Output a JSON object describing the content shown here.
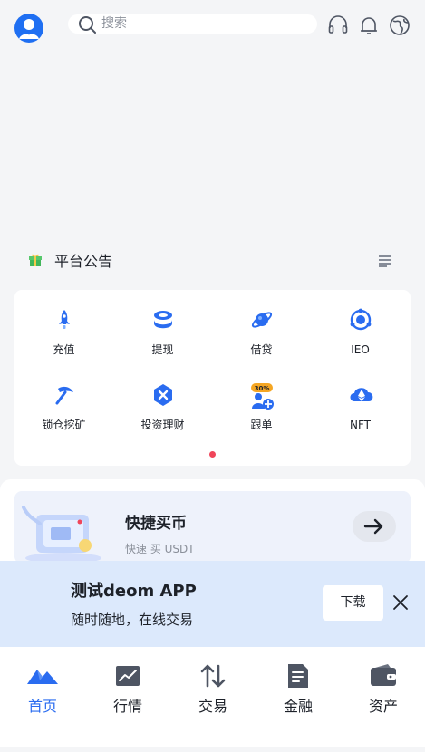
{
  "header": {
    "search_placeholder": "搜索",
    "icons": [
      "user-avatar-icon",
      "search-icon",
      "headset-icon",
      "bell-icon",
      "globe-icon"
    ]
  },
  "notice": {
    "title": "平台公告",
    "icons": [
      "gift-icon",
      "list-menu-icon"
    ]
  },
  "grid": {
    "items": [
      {
        "label": "充值",
        "icon": "rocket-icon"
      },
      {
        "label": "提现",
        "icon": "coin-stack-icon"
      },
      {
        "label": "借贷",
        "icon": "planet-icon"
      },
      {
        "label": "IEO",
        "icon": "target-icon"
      },
      {
        "label": "锁仓挖矿",
        "icon": "pickaxe-icon"
      },
      {
        "label": "投资理财",
        "icon": "hexagon-x-icon"
      },
      {
        "label": "跟单",
        "icon": "copy-trade-icon",
        "badge": "30%"
      },
      {
        "label": "NFT",
        "icon": "cloud-ethereum-icon"
      }
    ],
    "page_indicator_active": 1
  },
  "quick_buy": {
    "title": "快捷买币",
    "subtitle": "快速 买 USDT",
    "icon": "arrow-right-icon"
  },
  "download_banner": {
    "title": "测试deom APP",
    "subtitle": "随时随地，在线交易",
    "button": "下载",
    "close_icon": "close-icon"
  },
  "tabbar": {
    "active_index": 0,
    "tabs": [
      {
        "label": "首页",
        "icon": "home-mountain-icon"
      },
      {
        "label": "行情",
        "icon": "market-chart-icon"
      },
      {
        "label": "交易",
        "icon": "trade-arrows-icon"
      },
      {
        "label": "金融",
        "icon": "finance-doc-icon"
      },
      {
        "label": "资产",
        "icon": "wallet-icon"
      }
    ]
  },
  "colors": {
    "accent": "#2a6cf0",
    "background": "#f4f5f7",
    "banner": "#dce9fc",
    "indicator": "#f0455a"
  }
}
